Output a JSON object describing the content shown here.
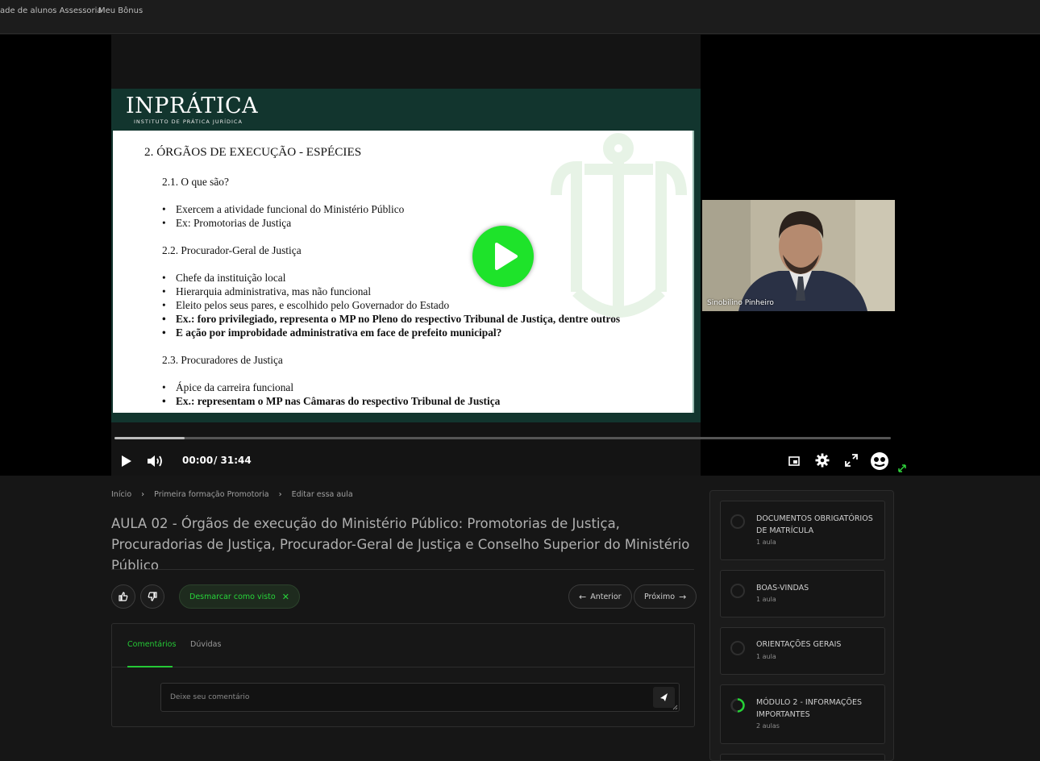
{
  "topnav": {
    "links": [
      "ade de alunos Assessoria",
      "Meu Bônus"
    ]
  },
  "slide": {
    "brand": "INPRÁTICA",
    "brand_sub": "INSTITUTO DE PRÁTICA JURÍDICA",
    "heading": "2. ÓRGÃOS DE EXECUÇÃO - ESPÉCIES",
    "sections": [
      {
        "title": "2.1. O que são?",
        "items": [
          {
            "text": "Exercem a atividade funcional do Ministério Público",
            "bold": false
          },
          {
            "text": "Ex: Promotorias de Justiça",
            "bold": false
          }
        ]
      },
      {
        "title": "2.2. Procurador-Geral de Justiça",
        "items": [
          {
            "text": "Chefe da instituição local",
            "bold": false
          },
          {
            "text": "Hierarquia administrativa, mas não funcional",
            "bold": false
          },
          {
            "text": "Eleito pelos seus pares, e escolhido pelo Governador do Estado",
            "bold": false
          },
          {
            "text": "Ex.: foro privilegiado, representa o MP no Pleno do respectivo Tribunal de Justiça, dentre outros",
            "bold": true
          },
          {
            "text": "E ação por improbidade administrativa em face de prefeito municipal?",
            "bold": true
          }
        ]
      },
      {
        "title": "2.3. Procuradores de Justiça",
        "items": [
          {
            "text": "Ápice da carreira funcional",
            "bold": false
          },
          {
            "text": "Ex.: representam o MP nas Câmaras do respectivo Tribunal de Justiça",
            "bold": true
          }
        ]
      }
    ]
  },
  "webcam": {
    "name": "Sinobilino Pinheiro"
  },
  "player": {
    "current_time": "00:00",
    "duration": "/ 31:44",
    "progress_fraction": 0.09,
    "icons": [
      "play-icon",
      "volume-icon",
      "picture-in-picture-icon",
      "settings-icon",
      "fullscreen-icon",
      "extension-icon",
      "resize-icon"
    ]
  },
  "breadcrumb": [
    "Início",
    "Primeira formação Promotoria",
    "Editar essa aula"
  ],
  "lesson_title": "AULA 02 - Órgãos de execução do Ministério Público: Promotorias de Justiça, Procuradorias de Justiça, Procurador-Geral de Justiça e Conselho Superior do Ministério Público",
  "actions": {
    "unmark_label": "Desmarcar como visto",
    "prev_label": "Anterior",
    "next_label": "Próximo"
  },
  "comments": {
    "tabs": [
      "Comentários",
      "Dúvidas"
    ],
    "active_tab": "Comentários",
    "placeholder": "Deixe seu comentário"
  },
  "modules": [
    {
      "title": "DOCUMENTOS OBRIGATÓRIOS DE MATRÍCULA",
      "count": "1 aula",
      "status": "empty"
    },
    {
      "title": "BOAS-VINDAS",
      "count": "1 aula",
      "status": "empty"
    },
    {
      "title": "ORIENTAÇÕES GERAIS",
      "count": "1 aula",
      "status": "empty"
    },
    {
      "title": "MÓDULO 2 - INFORMAÇÕES IMPORTANTES",
      "count": "2 aulas",
      "status": "in-progress"
    }
  ],
  "colors": {
    "accent": "#1ee32a",
    "slide_header": "#12352e",
    "background": "#161616"
  }
}
